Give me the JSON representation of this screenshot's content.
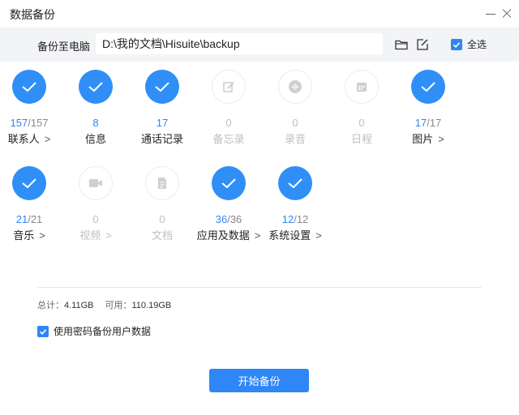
{
  "window": {
    "title": "数据备份"
  },
  "path_bar": {
    "label": "备份至电脑",
    "path": "D:\\我的文档\\Hisuite\\backup",
    "select_all_label": "全选",
    "select_all_checked": true
  },
  "categories": [
    {
      "id": "contacts",
      "label": "联系人",
      "selected": "157",
      "total": "157",
      "enabled": true,
      "arrow": ">"
    },
    {
      "id": "messages",
      "label": "信息",
      "selected": "8",
      "enabled": true
    },
    {
      "id": "call-log",
      "label": "通话记录",
      "selected": "17",
      "enabled": true
    },
    {
      "id": "memo",
      "label": "备忘录",
      "selected": "0",
      "enabled": false,
      "icon": "memo-icon"
    },
    {
      "id": "recordings",
      "label": "录音",
      "selected": "0",
      "enabled": false,
      "icon": "recording-icon"
    },
    {
      "id": "calendar",
      "label": "日程",
      "selected": "0",
      "enabled": false,
      "icon": "calendar-icon"
    },
    {
      "id": "pictures",
      "label": "图片",
      "selected": "17",
      "total": "17",
      "enabled": true,
      "arrow": ">"
    },
    {
      "id": "music",
      "label": "音乐",
      "selected": "21",
      "total": "21",
      "enabled": true,
      "arrow": ">"
    },
    {
      "id": "videos",
      "label": "视频",
      "selected": "0",
      "enabled": false,
      "icon": "video-icon",
      "arrow": ">"
    },
    {
      "id": "documents",
      "label": "文档",
      "selected": "0",
      "enabled": false,
      "icon": "document-icon"
    },
    {
      "id": "apps",
      "label": "应用及数据",
      "selected": "36",
      "total": "36",
      "enabled": true,
      "arrow": ">"
    },
    {
      "id": "system-settings",
      "label": "系统设置",
      "selected": "12",
      "total": "12",
      "enabled": true,
      "arrow": ">"
    }
  ],
  "summary": {
    "total_label": "总计：",
    "total_value": "4.11GB",
    "available_label": "可用：",
    "available_value": "110.19GB"
  },
  "password_option": {
    "label": "使用密码备份用户数据",
    "checked": true
  },
  "start_button": {
    "label": "开始备份"
  },
  "colors": {
    "accent": "#2f86f6",
    "check_circle": "#2f8ff7",
    "disabled_text": "#bfbfbf",
    "path_bar_bg": "#f3f4f6"
  }
}
